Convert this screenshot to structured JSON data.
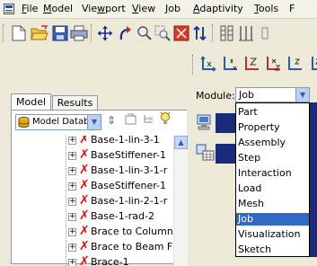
{
  "menubar": {
    "items": [
      {
        "label": "File",
        "ul": "F",
        "rest": "ile"
      },
      {
        "label": "Model",
        "ul": "M",
        "rest": "odel"
      },
      {
        "label": "Viewport",
        "ul": "",
        "rest": ""
      },
      {
        "label": "View",
        "ul": "V",
        "rest": "iew"
      },
      {
        "label": "Job",
        "ul": "J",
        "rest": "ob"
      },
      {
        "label": "Adaptivity",
        "ul": "A",
        "rest": "daptivity"
      },
      {
        "label": "Tools",
        "ul": "T",
        "rest": "ools"
      },
      {
        "label": "F",
        "ul": "F",
        "rest": ""
      }
    ],
    "viewport_a": "Vie",
    "viewport_ul": "w",
    "viewport_b": "port"
  },
  "panel": {
    "tabs": {
      "model": "Model",
      "results": "Results"
    },
    "db_selector": "Model Datab"
  },
  "tree": {
    "items": [
      "Base-1-lin-3-1",
      "BaseStiffener-1",
      "Base-1-lin-3-1-r",
      "BaseStiffener-1",
      "Base-1-lin-2-1-r",
      "Base-1-rad-2",
      "Brace to Column",
      "Brace to Beam F",
      "Brace-1"
    ]
  },
  "module": {
    "label": "Module:",
    "value": "Job",
    "options": [
      "Part",
      "Property",
      "Assembly",
      "Step",
      "Interaction",
      "Load",
      "Mesh",
      "Job",
      "Visualization",
      "Sketch"
    ],
    "selected": "Job"
  },
  "colors": {
    "selection": "#316ac5",
    "error_x": "#e01010",
    "accent": "#1b2a7a"
  }
}
